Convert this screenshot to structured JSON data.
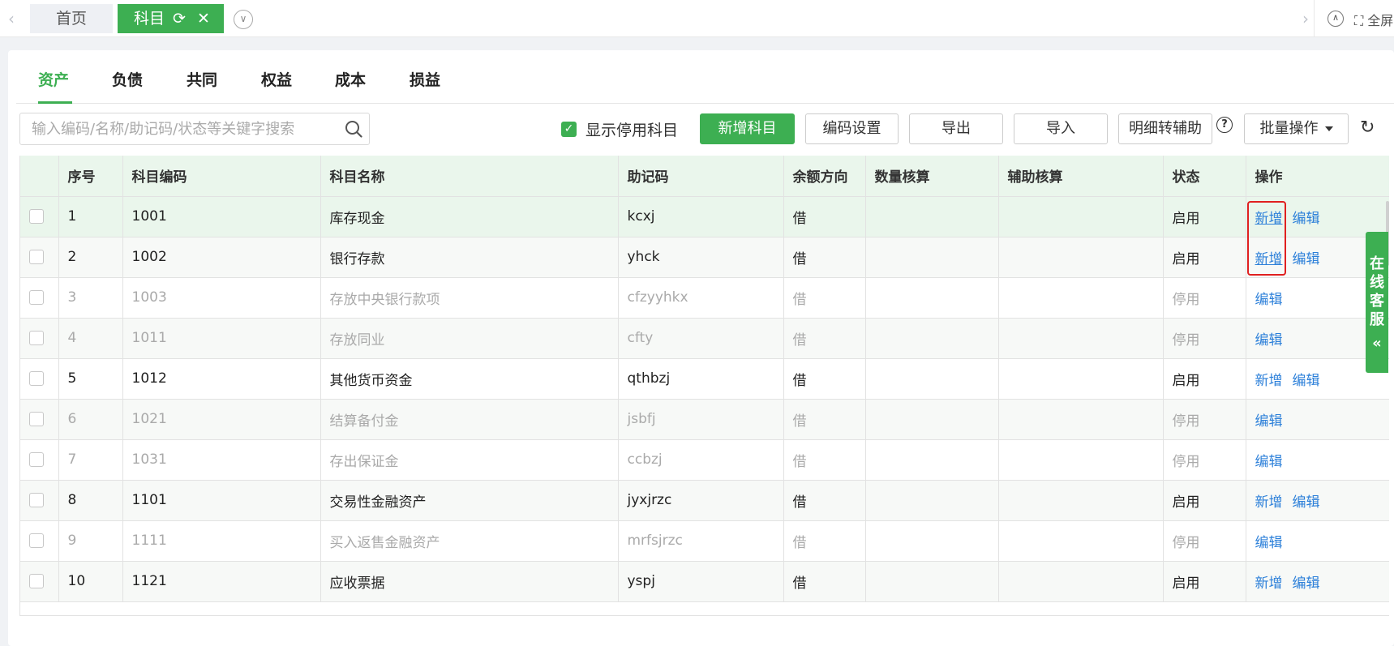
{
  "topbar": {
    "left_arrow": "‹",
    "right_arrow": "›",
    "home_tab": "首页",
    "active_tab": "科目",
    "fullscreen_label": "全屏"
  },
  "categories": [
    "资产",
    "负债",
    "共同",
    "权益",
    "成本",
    "损益"
  ],
  "toolbar": {
    "search_placeholder": "输入编码/名称/助记码/状态等关键字搜索",
    "show_disabled_label": "显示停用科目",
    "add_button": "新增科目",
    "code_settings_button": "编码设置",
    "export_button": "导出",
    "import_button": "导入",
    "detail_to_aux_button": "明细转辅助",
    "batch_button": "批量操作"
  },
  "table": {
    "headers": [
      "序号",
      "科目编码",
      "科目名称",
      "助记码",
      "余额方向",
      "数量核算",
      "辅助核算",
      "状态",
      "操作"
    ],
    "rows": [
      {
        "no": "1",
        "code": "1001",
        "name": "库存现金",
        "mnemonic": "kcxj",
        "direction": "借",
        "qty": "",
        "aux": "",
        "status": "启用",
        "ops": [
          "新增",
          "编辑"
        ]
      },
      {
        "no": "2",
        "code": "1002",
        "name": "银行存款",
        "mnemonic": "yhck",
        "direction": "借",
        "qty": "",
        "aux": "",
        "status": "启用",
        "ops": [
          "新增",
          "编辑"
        ]
      },
      {
        "no": "3",
        "code": "1003",
        "name": "存放中央银行款项",
        "mnemonic": "cfzyyhkx",
        "direction": "借",
        "qty": "",
        "aux": "",
        "status": "停用",
        "ops": [
          "编辑"
        ]
      },
      {
        "no": "4",
        "code": "1011",
        "name": "存放同业",
        "mnemonic": "cfty",
        "direction": "借",
        "qty": "",
        "aux": "",
        "status": "停用",
        "ops": [
          "编辑"
        ]
      },
      {
        "no": "5",
        "code": "1012",
        "name": "其他货币资金",
        "mnemonic": "qthbzj",
        "direction": "借",
        "qty": "",
        "aux": "",
        "status": "启用",
        "ops": [
          "新增",
          "编辑"
        ]
      },
      {
        "no": "6",
        "code": "1021",
        "name": "结算备付金",
        "mnemonic": "jsbfj",
        "direction": "借",
        "qty": "",
        "aux": "",
        "status": "停用",
        "ops": [
          "编辑"
        ]
      },
      {
        "no": "7",
        "code": "1031",
        "name": "存出保证金",
        "mnemonic": "ccbzj",
        "direction": "借",
        "qty": "",
        "aux": "",
        "status": "停用",
        "ops": [
          "编辑"
        ]
      },
      {
        "no": "8",
        "code": "1101",
        "name": "交易性金融资产",
        "mnemonic": "jyxjrzc",
        "direction": "借",
        "qty": "",
        "aux": "",
        "status": "启用",
        "ops": [
          "新增",
          "编辑"
        ]
      },
      {
        "no": "9",
        "code": "1111",
        "name": "买入返售金融资产",
        "mnemonic": "mrfsjrzc",
        "direction": "借",
        "qty": "",
        "aux": "",
        "status": "停用",
        "ops": [
          "编辑"
        ]
      },
      {
        "no": "10",
        "code": "1121",
        "name": "应收票据",
        "mnemonic": "yspj",
        "direction": "借",
        "qty": "",
        "aux": "",
        "status": "启用",
        "ops": [
          "新增",
          "编辑"
        ]
      }
    ]
  },
  "side_service": {
    "chars": [
      "在",
      "线",
      "客",
      "服"
    ],
    "chevron": "«"
  },
  "colors": {
    "accent": "#3daf52",
    "link": "#2b7fd9",
    "header_bg": "#eaf6ec",
    "highlight_box": "#e02020"
  }
}
